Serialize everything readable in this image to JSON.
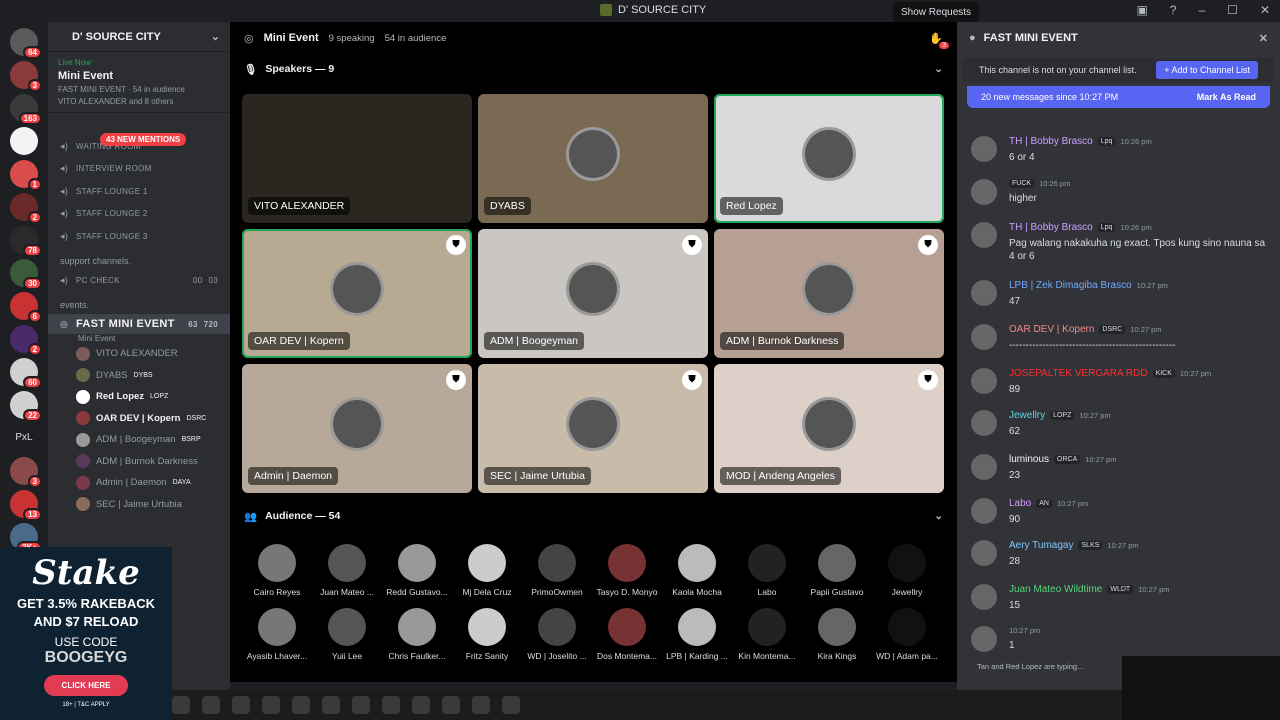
{
  "window": {
    "title": "D' SOURCE CITY",
    "tooltip": "Show Requests"
  },
  "rail": {
    "badges": [
      "64",
      "3",
      "163",
      "",
      "1",
      "2",
      "78",
      "30",
      "6",
      "2",
      "60",
      "22",
      "",
      "3",
      "13",
      "3K+"
    ],
    "pxl": "PxL"
  },
  "server": {
    "name": "D' SOURCE CITY"
  },
  "live": {
    "status": "Live Now",
    "title": "Mini Event",
    "info": "FAST MINI EVENT · 54 in audience",
    "people": "VITO ALEXANDER and 8 others"
  },
  "mentions": "43 NEW MENTIONS",
  "channels": [
    "WAITING ROOM",
    "INTERVIEW ROOM",
    "STAFF LOUNGE 1",
    "STAFF LOUNGE 2",
    "STAFF LOUNGE 3"
  ],
  "cat_support": "support channels.",
  "pc_check": {
    "name": "PC CHECK",
    "a": "00",
    "b": "03"
  },
  "cat_events": "events.",
  "active_channel": {
    "name": "FAST MINI EVENT",
    "sub": "Mini Event",
    "cam": "63",
    "count": "720"
  },
  "voice_members": [
    {
      "name": "VITO ALEXANDER",
      "tag": ""
    },
    {
      "name": "DYABS",
      "tag": "DYBS"
    },
    {
      "name": "Red Lopez",
      "tag": "LOPZ"
    },
    {
      "name": "OAR DEV | Kopern",
      "tag": "DSRC"
    },
    {
      "name": "ADM | Boogeyman",
      "tag": "BSRP"
    },
    {
      "name": "ADM | Burnok Darkness",
      "tag": ""
    },
    {
      "name": "Admin | Daemon",
      "tag": "DAYA"
    },
    {
      "name": "SEC | Jaime Urtubia",
      "tag": ""
    }
  ],
  "ad": {
    "brand": "Stake",
    "line1": "GET 3.5% RAKEBACK",
    "line2": "AND $7 RELOAD",
    "line3": "USE CODE",
    "code": "BOOGEYG",
    "button": "CLICK HERE",
    "fine": "18+ | T&C APPLY"
  },
  "stage": {
    "title": "Mini Event",
    "speaking": "9 speaking",
    "audience": "54 in audience",
    "speakers_label": "Speakers — 9",
    "audience_label": "Audience — 54",
    "req_badge": "3"
  },
  "speakers": [
    "VITO ALEXANDER",
    "DYABS",
    "Red Lopez",
    "OAR DEV | Kopern",
    "ADM | Boogeyman",
    "ADM | Burnok Darkness",
    "Admin | Daemon",
    "SEC | Jaime Urtubia",
    "MOD | Andeng Angeles"
  ],
  "audience": [
    "Cairo Reyes",
    "Juan Mateo ...",
    "Redd Gustavo...",
    "Mj Dela Cruz",
    "PrimoOwmen",
    "Tasyo D. Monyo",
    "Kaola Mocha",
    "Labo",
    "Papii Gustavo",
    "Jewellry",
    "Ayasib Lhaver...",
    "Yuii Lee",
    "Chris Faulker...",
    "Fritz Sanity",
    "WD | Joselito ...",
    "Dos Montema...",
    "LPB | Karding ...",
    "Kin Montema...",
    "Kira Kings",
    "WD | Adam pa..."
  ],
  "chat": {
    "channel": "FAST MINI EVENT",
    "not_listed": "This channel is not on your channel list.",
    "add_btn": "+ Add to Channel List",
    "new_msgs": "20 new messages since 10:27 PM",
    "mark_read": "Mark As Read",
    "typing": "Tan and Red Lopez are typing...",
    "messages": [
      {
        "name": "TH | Bobby Brasco",
        "tag": "Lpq",
        "time": "10:26 pm",
        "text": "6 or 4",
        "color": "#c9a0ff"
      },
      {
        "name": "",
        "tag": "FUCK",
        "time": "10:26 pm",
        "text": "higher",
        "color": "#dbdee1"
      },
      {
        "name": "TH | Bobby Brasco",
        "tag": "Lpq",
        "time": "10:26 pm",
        "text": "Pag walang nakakuha ng exact. Tpos kung sino nauna sa 4 or 6",
        "color": "#c9a0ff"
      },
      {
        "name": "LPB | Zek Dimagiba Brasco",
        "tag": "",
        "time": "10:27 pm",
        "text": "47",
        "color": "#6fa8ff"
      },
      {
        "name": "OAR DEV | Kopern",
        "tag": "DSRC",
        "time": "10:27 pm",
        "text": "--------------------------------------------------",
        "color": "#f08a8a"
      },
      {
        "name": "JOSEPALTEK VERGARA RDD",
        "tag": "KICK",
        "time": "10:27 pm",
        "text": "89",
        "color": "#ff2d2d"
      },
      {
        "name": "Jewellry",
        "tag": "LOPZ",
        "time": "10:27 pm",
        "text": "62",
        "color": "#5ad6e0"
      },
      {
        "name": "luminous",
        "tag": "ORCA",
        "time": "10:27 pm",
        "text": "23",
        "color": "#f2f3f5"
      },
      {
        "name": "Labo",
        "tag": "AN",
        "time": "10:27 pm",
        "text": "90",
        "color": "#d79bff"
      },
      {
        "name": "Aery Tumagay",
        "tag": "SLKS",
        "time": "10:27 pm",
        "text": "28",
        "color": "#7fc7ff"
      },
      {
        "name": "Juan Mateo Wildtime",
        "tag": "WLDT",
        "time": "10:27 pm",
        "text": "15",
        "color": "#59d37a"
      },
      {
        "name": "",
        "tag": "",
        "time": "10:27 pm",
        "text": "1",
        "color": "#dbdee1"
      }
    ]
  }
}
